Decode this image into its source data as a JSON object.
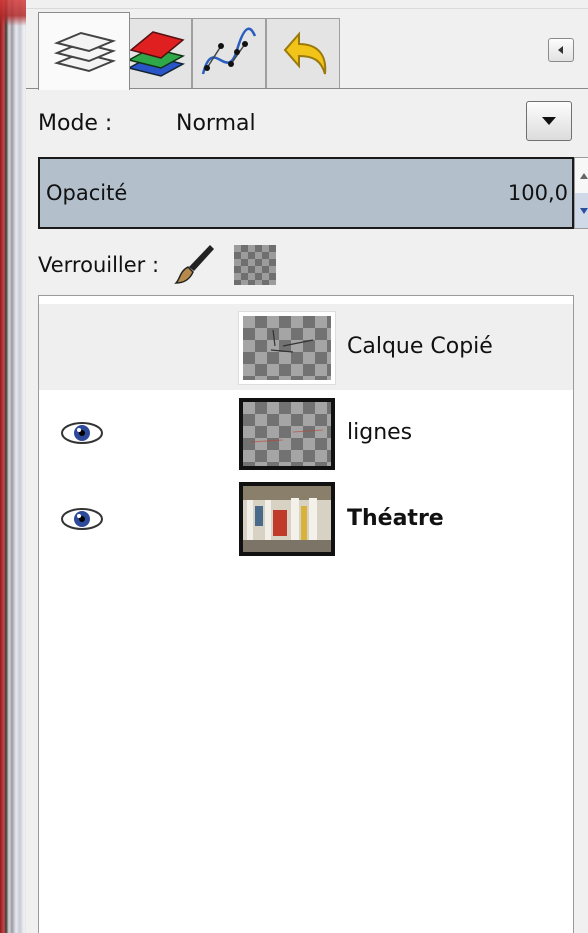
{
  "tabs": [
    {
      "icon": "layers-icon",
      "active": true
    },
    {
      "icon": "channels-icon",
      "active": false
    },
    {
      "icon": "paths-icon",
      "active": false
    },
    {
      "icon": "undo-history-icon",
      "active": false
    }
  ],
  "collapse_icon": "tab-menu-arrow-icon",
  "mode": {
    "label": "Mode :",
    "value": "Normal"
  },
  "opacity": {
    "label": "Opacité",
    "value": "100,0",
    "fraction": 1.0
  },
  "lock": {
    "label": "Verrouiller :",
    "icons": [
      "paint-brush-icon",
      "alpha-checker-icon"
    ]
  },
  "layers": [
    {
      "name": "Calque Copié",
      "visible": false,
      "selected": true,
      "bold": false,
      "thumb": "transparent"
    },
    {
      "name": "lignes",
      "visible": true,
      "selected": false,
      "bold": false,
      "thumb": "transparent"
    },
    {
      "name": "Théatre",
      "visible": true,
      "selected": false,
      "bold": true,
      "thumb": "photo"
    }
  ],
  "colors": {
    "opacity_bar": "#b3c0cc",
    "selected_row": "#efefef"
  }
}
